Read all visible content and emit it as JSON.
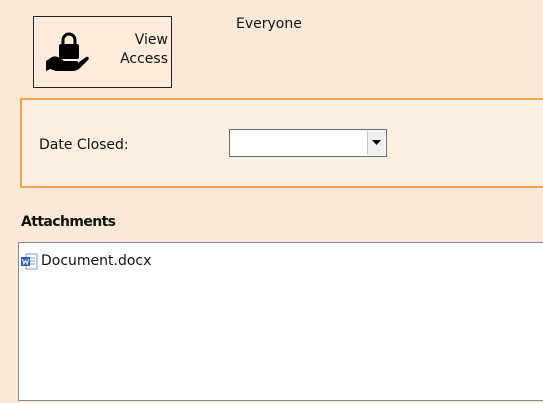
{
  "toolbar": {
    "view_access_label": "View Access",
    "view_access_line1": "View",
    "view_access_line2": "Access",
    "view_access_icon": "hand-lock-icon",
    "everyone_text": "Everyone"
  },
  "date_closed": {
    "label": "Date Closed:",
    "value": "",
    "dropdown_icon": "chevron-down-icon"
  },
  "attachments": {
    "heading": "Attachments",
    "items": [
      {
        "name": "Document.docx",
        "icon": "word-document-icon"
      }
    ]
  },
  "colors": {
    "background": "#fbe9d8",
    "panel_border": "#f0a54a",
    "panel_background": "#fcefe2"
  }
}
